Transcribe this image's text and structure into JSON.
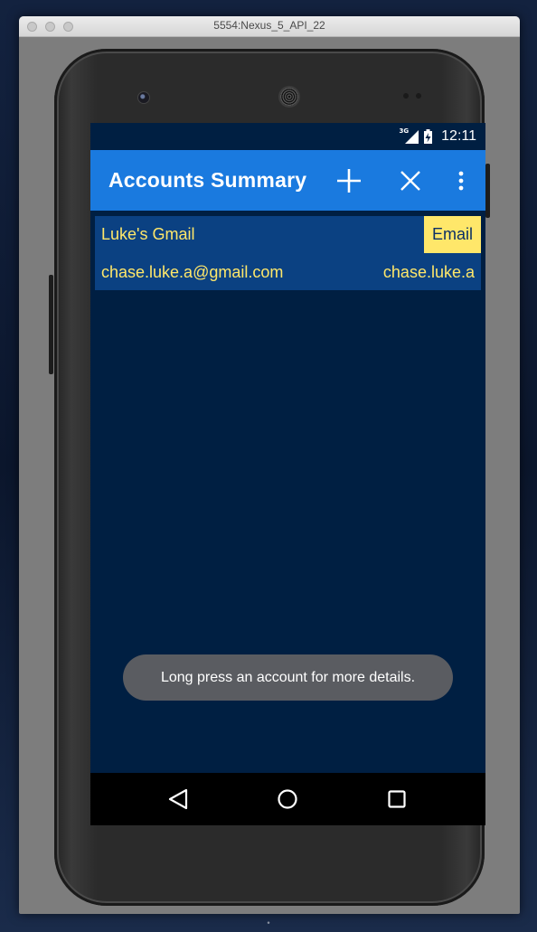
{
  "window": {
    "title": "5554:Nexus_5_API_22"
  },
  "status_bar": {
    "network_type": "3G",
    "time": "12:11"
  },
  "app_bar": {
    "title": "Accounts Summary",
    "actions": [
      {
        "name": "add-icon"
      },
      {
        "name": "close-icon"
      },
      {
        "name": "overflow-menu-icon"
      }
    ]
  },
  "accounts": [
    {
      "name": "Luke's Gmail",
      "type": "Email",
      "email": "chase.luke.a@gmail.com",
      "username": "chase.luke.a"
    }
  ],
  "toast": {
    "message": "Long press an account for more details."
  },
  "nav_bar": {
    "buttons": [
      "back-icon",
      "home-icon",
      "recents-icon"
    ]
  },
  "colors": {
    "app_bar": "#1a7adf",
    "background": "#001f42",
    "card": "#0b4182",
    "accent_text": "#ffe76a",
    "toast": "#5a5c61"
  }
}
